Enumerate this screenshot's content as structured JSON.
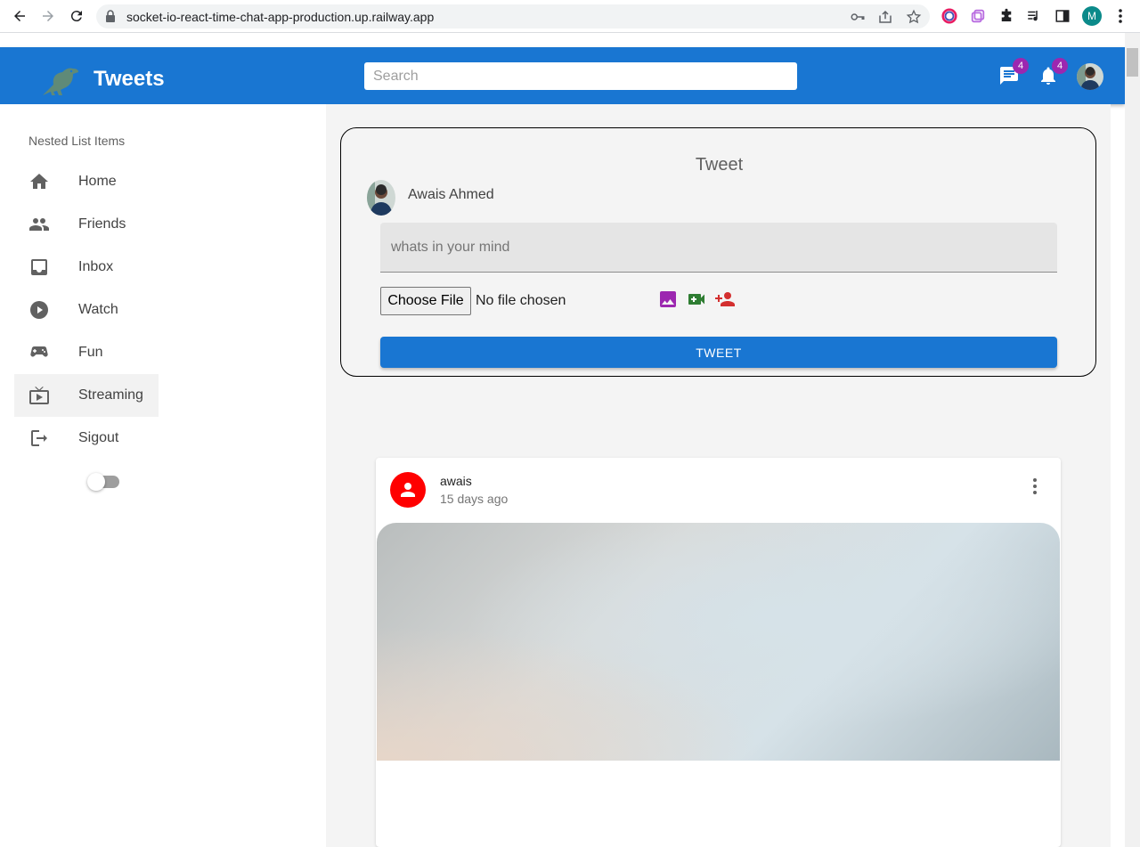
{
  "browser": {
    "url": "socket-io-react-time-chat-app-production.up.railway.app",
    "profile_initial": "M"
  },
  "appbar": {
    "title": "Tweets",
    "search_placeholder": "Search",
    "messages_badge": "4",
    "notifications_badge": "4"
  },
  "sidebar": {
    "header": "Nested List Items",
    "items": [
      {
        "label": "Home",
        "icon": "home-icon"
      },
      {
        "label": "Friends",
        "icon": "people-icon"
      },
      {
        "label": "Inbox",
        "icon": "inbox-icon"
      },
      {
        "label": "Watch",
        "icon": "play-circle-icon"
      },
      {
        "label": "Fun",
        "icon": "gamepad-icon"
      },
      {
        "label": "Streaming",
        "icon": "tv-icon"
      },
      {
        "label": "Sigout",
        "icon": "logout-icon"
      }
    ],
    "active_item": "Streaming",
    "dark_mode_on": false
  },
  "compose": {
    "title": "Tweet",
    "user_name": "Awais Ahmed",
    "input_placeholder": "whats in your mind",
    "file_button": "Choose File",
    "file_status": "No file chosen",
    "submit_label": "TWEET"
  },
  "post": {
    "user": "awais",
    "time": "15 days ago"
  },
  "colors": {
    "primary": "#1976d2",
    "badge": "#9c27b0",
    "post_avatar": "#ff0000",
    "photo_icon": "#9c27b0",
    "video_icon": "#2e7d32",
    "tag_icon": "#d32f2f"
  }
}
